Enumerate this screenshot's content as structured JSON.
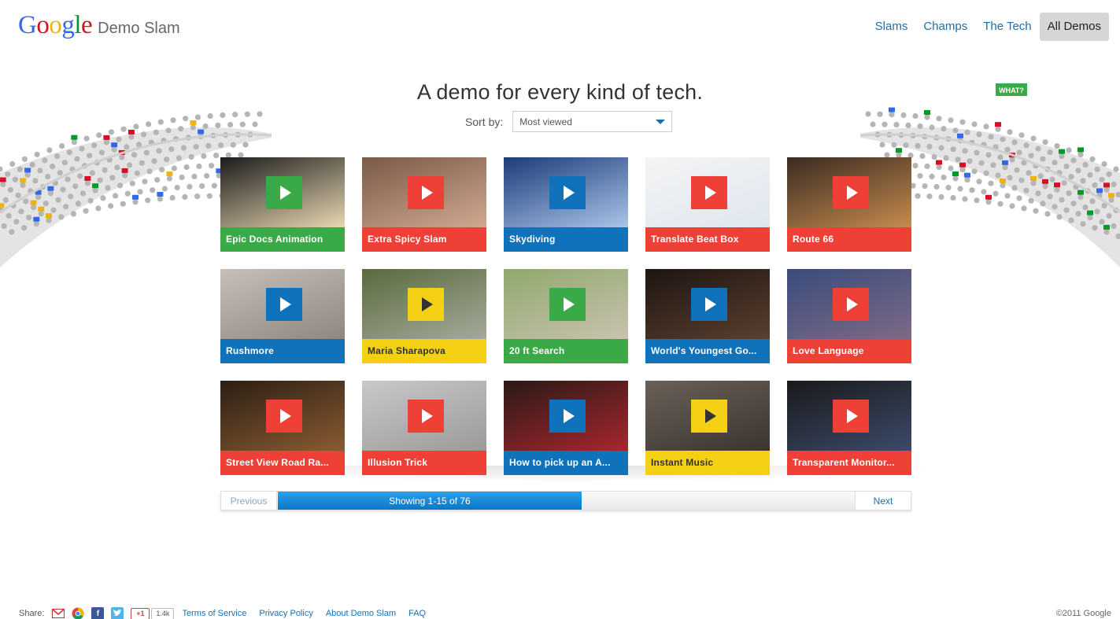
{
  "header": {
    "logo_letters": [
      "G",
      "o",
      "o",
      "g",
      "l",
      "e"
    ],
    "logo_colors": [
      "#3369e8",
      "#d50f25",
      "#eeb211",
      "#3369e8",
      "#009925",
      "#d50f25"
    ],
    "subtitle": "Demo Slam"
  },
  "nav": {
    "items": [
      {
        "label": "Slams",
        "active": false
      },
      {
        "label": "Champs",
        "active": false
      },
      {
        "label": "The Tech",
        "active": false
      },
      {
        "label": "All Demos",
        "active": true
      }
    ]
  },
  "main": {
    "headline": "A demo for every kind of tech.",
    "sort_label": "Sort by:",
    "sort_value": "Most viewed"
  },
  "colors": {
    "green": "#3aaa48",
    "red": "#ee4036",
    "blue": "#0f72ba",
    "yellow": "#f4d015"
  },
  "demos": [
    {
      "title": "Epic Docs Animation",
      "color": "green"
    },
    {
      "title": "Extra Spicy Slam",
      "color": "red"
    },
    {
      "title": "Skydiving",
      "color": "blue"
    },
    {
      "title": "Translate Beat Box",
      "color": "red"
    },
    {
      "title": "Route 66",
      "color": "red"
    },
    {
      "title": "Rushmore",
      "color": "blue"
    },
    {
      "title": "Maria Sharapova",
      "color": "yellow"
    },
    {
      "title": "20 ft Search",
      "color": "green"
    },
    {
      "title": "World's Youngest Go...",
      "color": "blue"
    },
    {
      "title": "Love Language",
      "color": "red"
    },
    {
      "title": "Street View Road Ra...",
      "color": "red"
    },
    {
      "title": "Illusion Trick",
      "color": "red"
    },
    {
      "title": "How to pick up an A...",
      "color": "blue"
    },
    {
      "title": "Instant Music",
      "color": "yellow"
    },
    {
      "title": "Transparent Monitor...",
      "color": "red"
    }
  ],
  "pager": {
    "prev": "Previous",
    "status": "Showing 1-15 of 76",
    "next": "Next",
    "progress_fraction": 0.44
  },
  "footer": {
    "share_label": "Share:",
    "share_icons": [
      "gmail-icon",
      "chrome-icon",
      "facebook-icon",
      "twitter-icon"
    ],
    "plusone_label": "+1",
    "plusone_count": "1.4k",
    "links": [
      "Terms of Service",
      "Privacy Policy",
      "About Demo Slam",
      "FAQ"
    ],
    "copyright": "©2011 Google"
  },
  "stadium_signs": {
    "right_sign": "WHAT?"
  }
}
